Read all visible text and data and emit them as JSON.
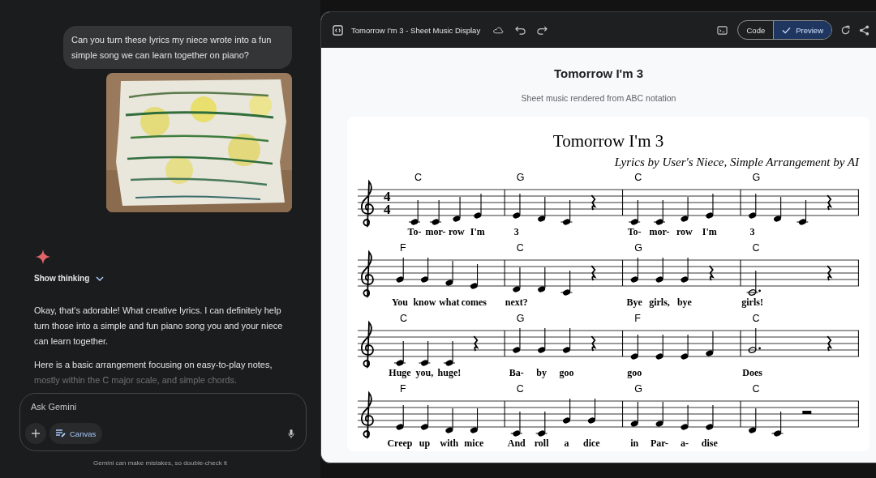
{
  "chat": {
    "user_message": "Can you turn these lyrics my niece wrote into a fun simple song we can learn together on piano?",
    "attachment": {
      "kind": "picture"
    },
    "show_thinking": "Show thinking",
    "response_paragraphs": [
      "Okay, that's adorable! What creative lyrics. I can definitely help turn those into a simple and fun piano song you and your niece can learn together.",
      "Here is a basic arrangement focusing on easy-to-play notes, mostly within the C major scale, and simple chords."
    ],
    "input": {
      "placeholder": "Ask Gemini"
    },
    "tool_chip": "Canvas",
    "disclaimer": "Gemini can make mistakes, so double-check it"
  },
  "canvas": {
    "title": "Tomorrow I'm 3 - Sheet Music Display",
    "view_toggle": [
      {
        "label": "Code",
        "selected": false
      },
      {
        "label": "Preview",
        "selected": true
      }
    ],
    "page": {
      "heading": "Tomorrow I'm 3",
      "subheading": "Sheet music rendered from ABC notation"
    },
    "score": {
      "title": "Tomorrow I'm 3",
      "attribution": "Lyrics by User's Niece, Simple Arrangement by AI",
      "time_signature": [
        "4",
        "4"
      ],
      "systems": [
        {
          "measures": [
            {
              "chord": "C",
              "notes": [
                {
                  "kind": "quarter_c4",
                  "lyric": "To-"
                },
                {
                  "kind": "quarter_c4",
                  "lyric": "mor-"
                },
                {
                  "kind": "quarter_d4",
                  "lyric": "row"
                },
                {
                  "kind": "quarter_e4",
                  "lyric": "I'm"
                }
              ]
            },
            {
              "chord": "G",
              "notes": [
                {
                  "kind": "quarter_e4",
                  "lyric": "3"
                },
                {
                  "kind": "quarter_d4"
                },
                {
                  "kind": "quarter_c4"
                },
                {
                  "kind": "quarter_rest"
                }
              ]
            },
            {
              "chord": "C",
              "notes": [
                {
                  "kind": "quarter_c4",
                  "lyric": "To-"
                },
                {
                  "kind": "quarter_c4",
                  "lyric": "mor-"
                },
                {
                  "kind": "quarter_d4",
                  "lyric": "row"
                },
                {
                  "kind": "quarter_e4",
                  "lyric": "I'm"
                }
              ]
            },
            {
              "chord": "G",
              "notes": [
                {
                  "kind": "quarter_e4",
                  "lyric": "3"
                },
                {
                  "kind": "quarter_d4"
                },
                {
                  "kind": "quarter_c4"
                },
                {
                  "kind": "quarter_rest"
                }
              ]
            }
          ]
        },
        {
          "measures": [
            {
              "chord": "F",
              "notes": [
                {
                  "kind": "quarter_g4",
                  "lyric": "You"
                },
                {
                  "kind": "quarter_g4",
                  "lyric": "know"
                },
                {
                  "kind": "quarter_f4",
                  "lyric": "what"
                },
                {
                  "kind": "quarter_e4",
                  "lyric": "comes"
                }
              ]
            },
            {
              "chord": "C",
              "notes": [
                {
                  "kind": "quarter_d4",
                  "lyric": "next?"
                },
                {
                  "kind": "quarter_d4"
                },
                {
                  "kind": "quarter_c4"
                },
                {
                  "kind": "quarter_rest"
                }
              ]
            },
            {
              "chord": "G",
              "notes": [
                {
                  "kind": "quarter_g4",
                  "lyric": "Bye"
                },
                {
                  "kind": "quarter_g4",
                  "lyric": "girls,"
                },
                {
                  "kind": "quarter_g4",
                  "lyric": "bye"
                },
                {
                  "kind": "quarter_rest"
                }
              ]
            },
            {
              "chord": "C",
              "notes": [
                {
                  "kind": "dotted_half_c4",
                  "lyric": "girls!"
                },
                {
                  "kind": "quarter_rest"
                }
              ]
            }
          ]
        },
        {
          "measures": [
            {
              "chord": "C",
              "notes": [
                {
                  "kind": "quarter_c4",
                  "lyric": "Huge"
                },
                {
                  "kind": "quarter_c4",
                  "lyric": "you,"
                },
                {
                  "kind": "quarter_c4",
                  "lyric": "huge!"
                },
                {
                  "kind": "quarter_rest"
                }
              ]
            },
            {
              "chord": "G",
              "notes": [
                {
                  "kind": "quarter_g4",
                  "lyric": "Ba-"
                },
                {
                  "kind": "quarter_g4",
                  "lyric": "by"
                },
                {
                  "kind": "quarter_g4",
                  "lyric": "goo"
                },
                {
                  "kind": "quarter_rest"
                }
              ]
            },
            {
              "chord": "F",
              "notes": [
                {
                  "kind": "quarter_e4",
                  "lyric": "goo"
                },
                {
                  "kind": "quarter_e4"
                },
                {
                  "kind": "quarter_e4"
                },
                {
                  "kind": "quarter_f4"
                }
              ]
            },
            {
              "chord": "C",
              "notes": [
                {
                  "kind": "dotted_half_g4",
                  "lyric": "Does"
                },
                {
                  "kind": "quarter_rest"
                }
              ]
            }
          ]
        },
        {
          "measures": [
            {
              "chord": "F",
              "notes": [
                {
                  "kind": "quarter_e4",
                  "lyric": "Creep"
                },
                {
                  "kind": "quarter_e4",
                  "lyric": "up"
                },
                {
                  "kind": "quarter_d4",
                  "lyric": "with"
                },
                {
                  "kind": "quarter_d4",
                  "lyric": "mice"
                }
              ]
            },
            {
              "chord": "C",
              "notes": [
                {
                  "kind": "quarter_c4",
                  "lyric": "And"
                },
                {
                  "kind": "quarter_c4",
                  "lyric": "roll"
                },
                {
                  "kind": "quarter_g4",
                  "lyric": "a"
                },
                {
                  "kind": "quarter_g4",
                  "lyric": "dice"
                }
              ]
            },
            {
              "chord": "G",
              "notes": [
                {
                  "kind": "quarter_f4",
                  "lyric": "in"
                },
                {
                  "kind": "quarter_f4",
                  "lyric": "Par-"
                },
                {
                  "kind": "quarter_e4",
                  "lyric": "a-"
                },
                {
                  "kind": "quarter_e4",
                  "lyric": "dise"
                }
              ]
            },
            {
              "chord": "C",
              "notes": [
                {
                  "kind": "quarter_d4"
                },
                {
                  "kind": "quarter_c4"
                },
                {
                  "kind": "half_rest"
                }
              ]
            }
          ]
        }
      ]
    }
  }
}
